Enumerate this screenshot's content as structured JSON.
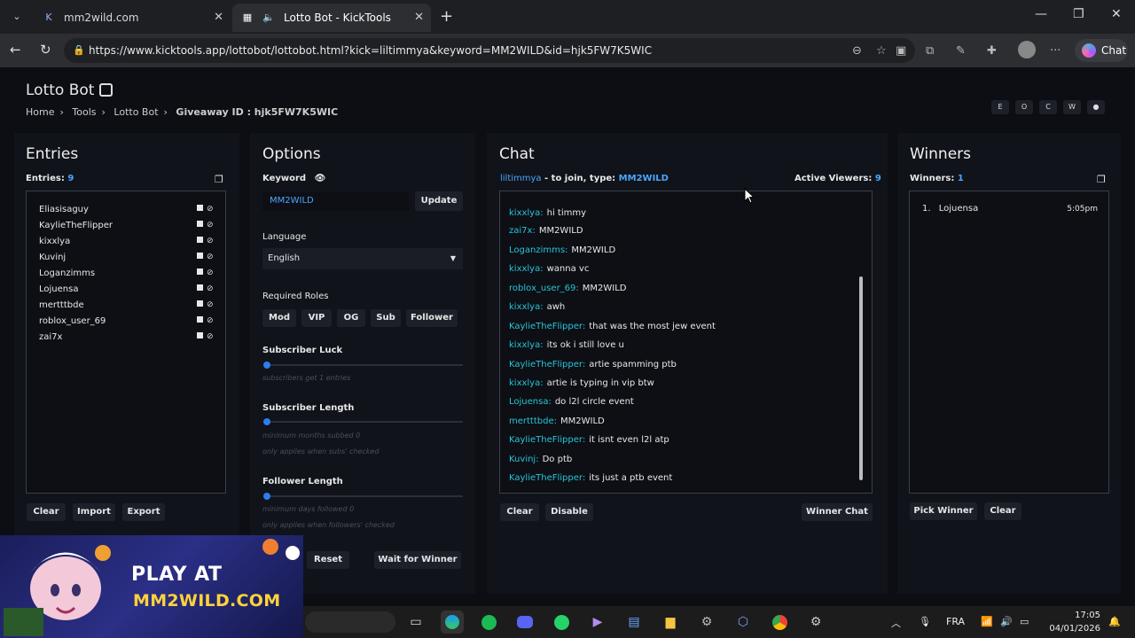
{
  "browser": {
    "tabs": [
      {
        "title": "mm2wild.com",
        "active": false
      },
      {
        "title": "Lotto Bot - KickTools",
        "active": true
      }
    ],
    "url": "https://www.kicktools.app/lottobot/lottobot.html?kick=liltimmya&keyword=MM2WILD&id=hjk5FW7K5WIC",
    "chat_label": "Chat"
  },
  "page": {
    "title": "Lotto Bot",
    "breadcrumb": [
      "Home",
      "Tools",
      "Lotto Bot",
      "Giveaway ID : hjk5FW7K5WIC"
    ],
    "lang_buttons": [
      "E",
      "O",
      "C",
      "W",
      "●"
    ]
  },
  "entries": {
    "heading": "Entries",
    "count_label": "Entries:",
    "count": "9",
    "items": [
      "Eliasisaguy",
      "KaylieTheFlipper",
      "kixxlya",
      "Kuvinj",
      "Loganzimms",
      "Lojuensa",
      "mertttbde",
      "roblox_user_69",
      "zai7x"
    ],
    "buttons": {
      "clear": "Clear",
      "import": "Import",
      "export": "Export"
    }
  },
  "options": {
    "heading": "Options",
    "keyword_label": "Keyword",
    "keyword_value": "MM2WILD",
    "update": "Update",
    "language_label": "Language",
    "language_value": "English",
    "roles_label": "Required Roles",
    "roles": [
      "Mod",
      "VIP",
      "OG",
      "Sub",
      "Follower"
    ],
    "sub_luck_label": "Subscriber Luck",
    "sub_luck_hint": "subscribers get 1 entries",
    "sub_length_label": "Subscriber Length",
    "sub_length_hint1": "minimum months subbed 0",
    "sub_length_hint2": "only applies when subs' checked",
    "follower_length_label": "Follower Length",
    "follower_length_hint1": "minimum days followed 0",
    "follower_length_hint2": "only applies when followers' checked",
    "reset": "Reset",
    "wait": "Wait for Winner"
  },
  "chat": {
    "heading": "Chat",
    "channel": "liltimmya",
    "join_text": "- to join, type:",
    "keyword": "MM2WILD",
    "viewers_label": "Active Viewers:",
    "viewers": "9",
    "messages": [
      {
        "user": "kixxlya:",
        "text": "hi timmy"
      },
      {
        "user": "zai7x:",
        "text": "MM2WILD"
      },
      {
        "user": "Loganzimms:",
        "text": "MM2WILD"
      },
      {
        "user": "kixxlya:",
        "text": "wanna vc"
      },
      {
        "user": "roblox_user_69:",
        "text": "MM2WILD"
      },
      {
        "user": "kixxlya:",
        "text": "awh"
      },
      {
        "user": "KaylieTheFlipper:",
        "text": "that was the most jew event"
      },
      {
        "user": "kixxlya:",
        "text": "its ok i still love u"
      },
      {
        "user": "KaylieTheFlipper:",
        "text": "artie spamming ptb"
      },
      {
        "user": "kixxlya:",
        "text": "artie is typing in vip btw"
      },
      {
        "user": "Lojuensa:",
        "text": "do l2l circle event"
      },
      {
        "user": "mertttbde:",
        "text": "MM2WILD"
      },
      {
        "user": "KaylieTheFlipper:",
        "text": "it isnt even l2l atp"
      },
      {
        "user": "Kuvinj:",
        "text": "Do ptb"
      },
      {
        "user": "KaylieTheFlipper:",
        "text": "its just a ptb event"
      }
    ],
    "buttons": {
      "clear": "Clear",
      "disable": "Disable",
      "winner_chat": "Winner Chat"
    }
  },
  "winners": {
    "heading": "Winners",
    "count_label": "Winners:",
    "count": "1",
    "items": [
      {
        "rank": "1.",
        "name": "Lojuensa",
        "time": "5:05pm"
      }
    ],
    "buttons": {
      "pick": "Pick Winner",
      "clear": "Clear"
    }
  },
  "ad": {
    "line1": "PLAY AT",
    "line2": "MM2WILD.COM"
  },
  "taskbar": {
    "lang": "FRA",
    "time": "17:05",
    "date": "04/01/2026"
  },
  "colors": {
    "accent": "#4aa6ff",
    "username": "#27c4d8",
    "slider": "#2a7ef0"
  }
}
